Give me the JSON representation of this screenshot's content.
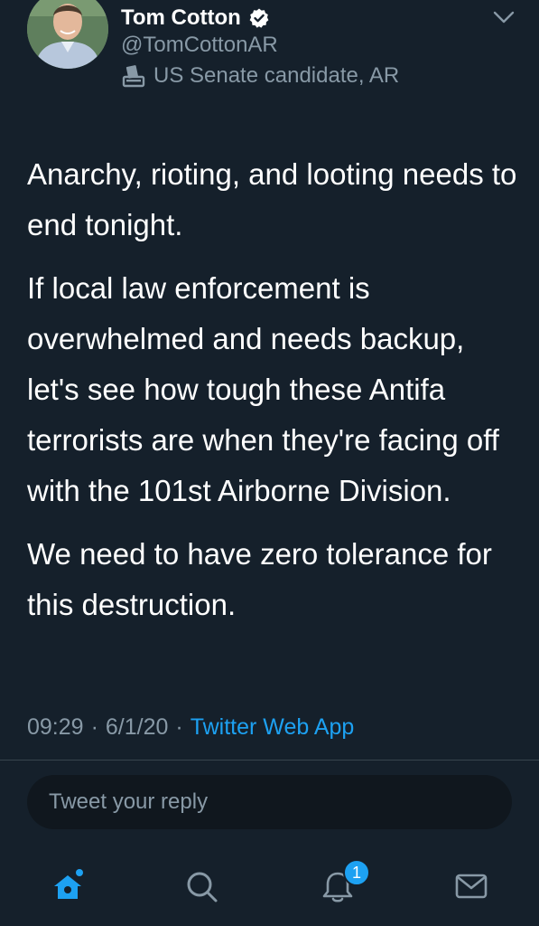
{
  "header": {
    "display_name": "Tom Cotton",
    "handle": "@TomCottonAR",
    "label": "US Senate candidate, AR"
  },
  "icons": {
    "verified": "verified-badge-icon",
    "label": "ballot-box-icon",
    "menu": "chevron-down-icon"
  },
  "tweet": {
    "paragraphs": [
      "Anarchy, rioting, and looting needs to end tonight.",
      "If local law enforcement is overwhelmed and needs backup, let's see how tough these Antifa terrorists are when they're facing off with the 101st Airborne Division.",
      "We need to have zero tolerance for this destruction."
    ],
    "time": "09:29",
    "date": "6/1/20",
    "separator": "·",
    "source": "Twitter Web App"
  },
  "reply": {
    "placeholder": "Tweet your reply"
  },
  "tab_bar": {
    "items": [
      "home-icon",
      "search-icon",
      "notifications-icon",
      "messages-icon"
    ],
    "notification_count": "1"
  },
  "colors": {
    "background": "#15202b",
    "accent": "#1da1f2",
    "muted_text": "#8899a6",
    "divider": "#38444d",
    "reply_box": "#10171e"
  }
}
